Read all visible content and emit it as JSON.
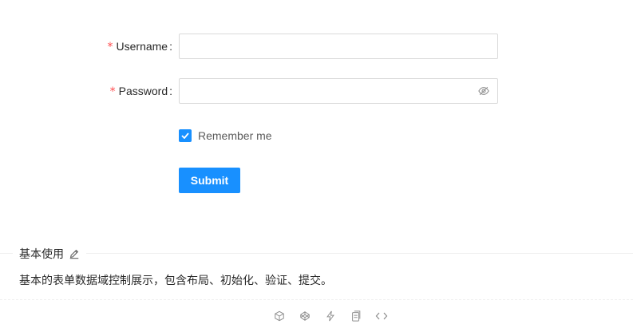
{
  "form": {
    "username": {
      "label": "Username",
      "required_mark": "*",
      "value": "",
      "placeholder": ""
    },
    "password": {
      "label": "Password",
      "required_mark": "*",
      "value": "",
      "placeholder": "",
      "icon": "eye-invisible-icon"
    },
    "colon": ":",
    "remember": {
      "label": "Remember me",
      "checked": true
    },
    "submit_label": "Submit"
  },
  "section": {
    "title": "基本使用",
    "description": "基本的表单数据域控制展示，包含布局、初始化、验证、提交。",
    "edit_icon": "edit-icon"
  },
  "code_actions": [
    "codesandbox-icon",
    "codepen-icon",
    "thunderbolt-icon",
    "copy-icon",
    "code-expand-icon"
  ],
  "colors": {
    "primary": "#1890ff",
    "required": "#ff4d4f",
    "border": "#d9d9d9"
  }
}
